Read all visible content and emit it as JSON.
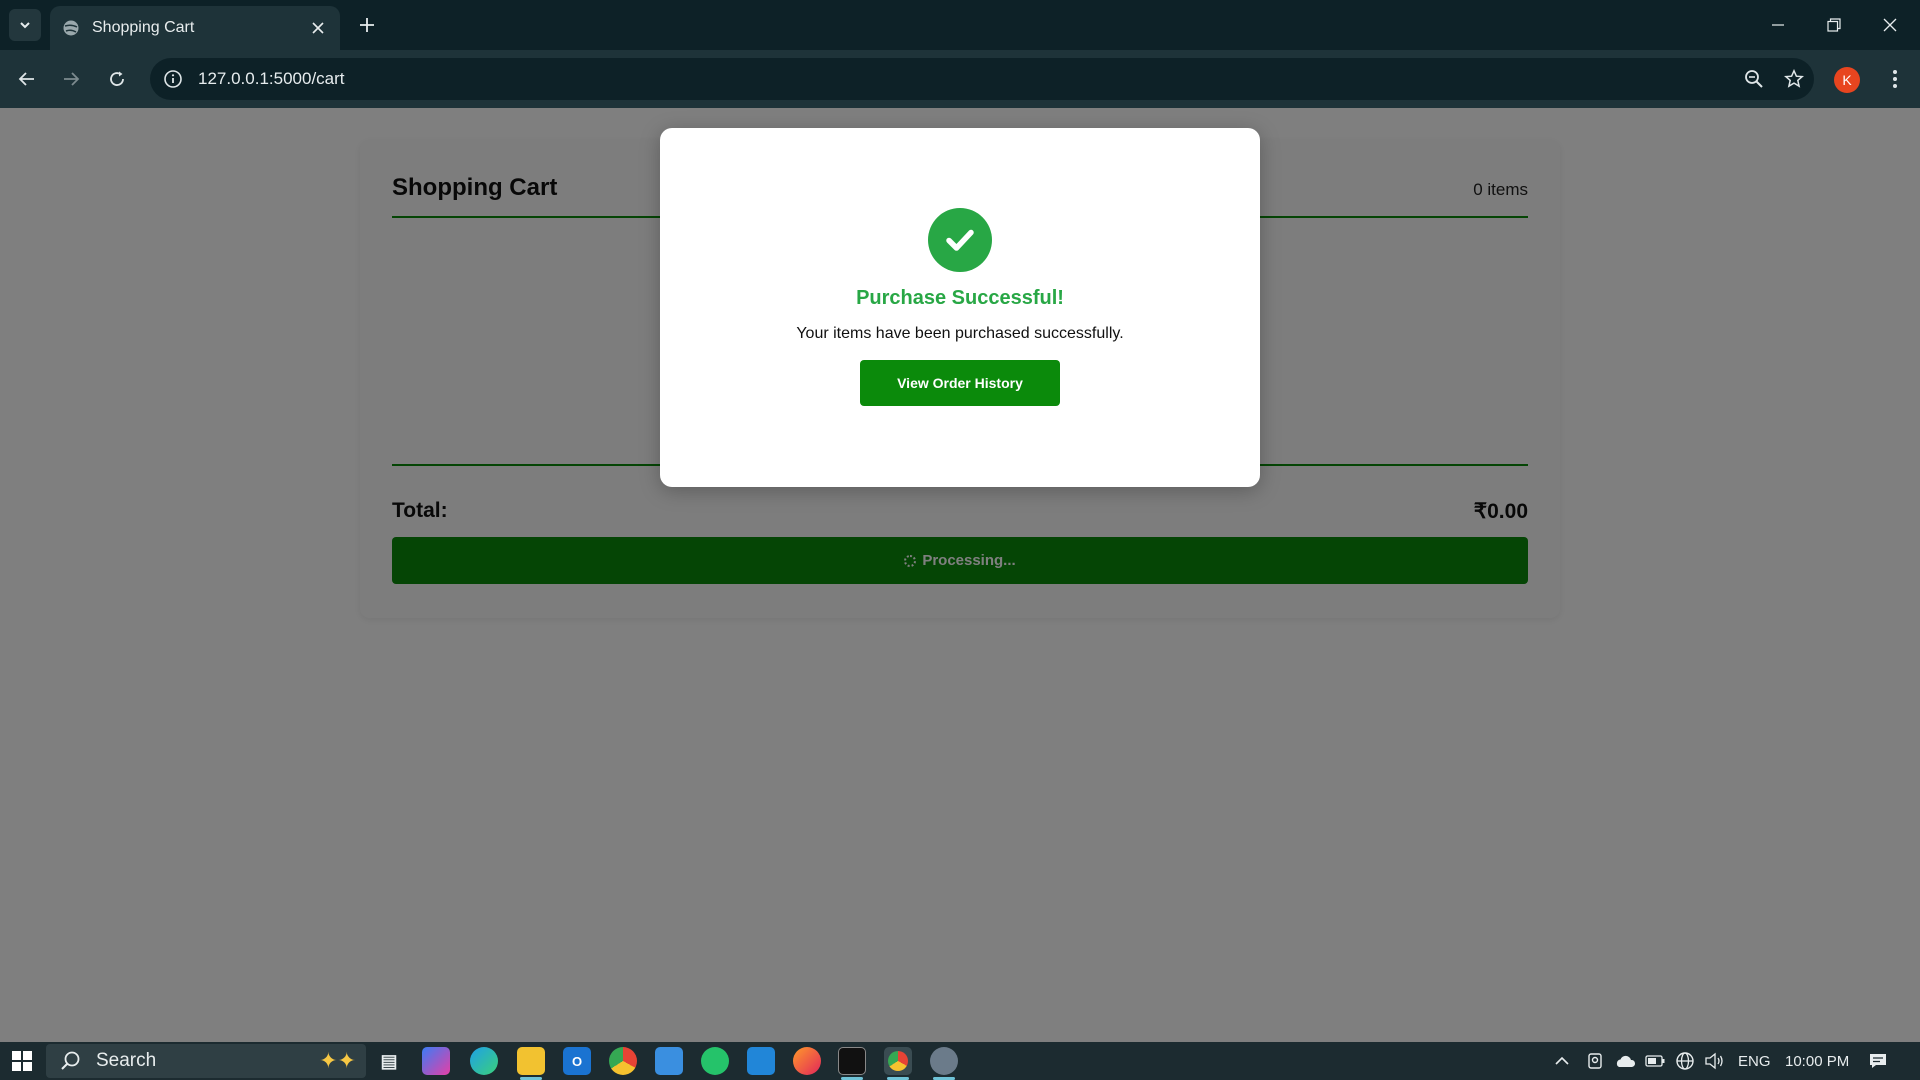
{
  "browser": {
    "tab_title": "Shopping Cart",
    "url": "127.0.0.1:5000/cart",
    "profile_initial": "K"
  },
  "page": {
    "title": "Shopping Cart",
    "items_count": "0 items",
    "total_label": "Total:",
    "total_value": "₹0.00",
    "checkout_label": "Processing..."
  },
  "modal": {
    "heading": "Purchase Successful!",
    "message": "Your items have been purchased successfully.",
    "button_label": "View Order History",
    "accent_color": "#28a745",
    "button_color": "#0b8a0b"
  },
  "taskbar": {
    "search_placeholder": "Search",
    "language": "ENG",
    "time": "10:00 PM",
    "apps": [
      "task-view-icon",
      "copilot-icon",
      "edge-icon",
      "file-explorer-icon",
      "outlook-icon",
      "chrome-icon",
      "store-icon",
      "whatsapp-icon",
      "vscode-icon",
      "firefox-icon",
      "terminal-icon",
      "chrome-active-icon",
      "app-icon"
    ]
  }
}
